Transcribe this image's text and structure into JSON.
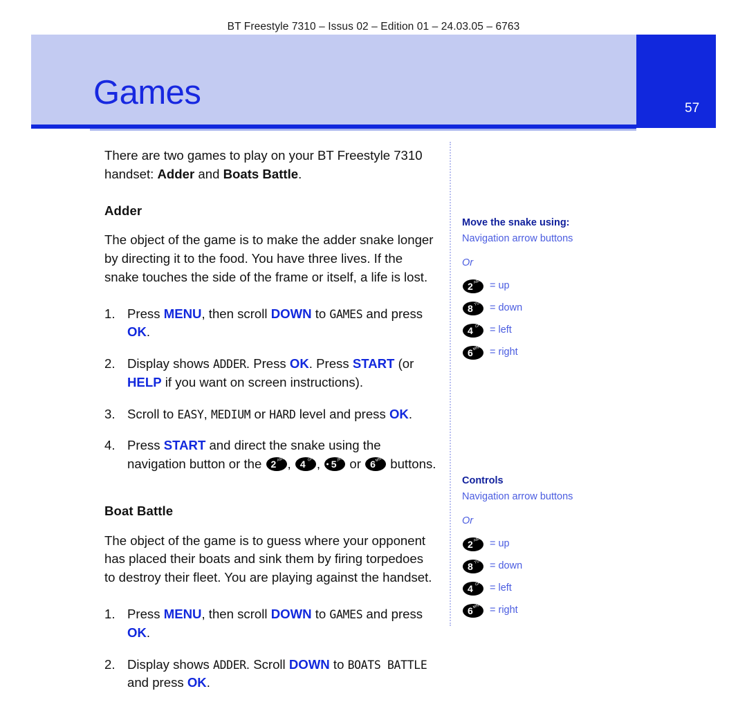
{
  "header": {
    "running_head": "BT Freestyle 7310 – Issus 02 – Edition 01 – 24.03.05 – 6763"
  },
  "banner": {
    "title": "Games",
    "page_number": "57",
    "bg_color": "#c3cbf2",
    "title_color": "#1728e0",
    "page_block_color": "#1128dd"
  },
  "main": {
    "intro": {
      "t1": "There are two games to play on your BT Freestyle 7310 handset: ",
      "b1": "Adder",
      "t2": " and ",
      "b2": "Boats Battle",
      "t3": "."
    },
    "adder": {
      "heading": "Adder",
      "description": "The object of the game is to make the adder snake longer by directing it to the food. You have three lives. If the snake touches the side of the frame or itself, a life is lost.",
      "steps": [
        {
          "num": "1.",
          "p1": "Press ",
          "k1": "MENU",
          "p2": ", then scroll ",
          "k2": "DOWN",
          "p3": " to ",
          "lcd1": "GAMES",
          "p4": " and press ",
          "k3": "OK",
          "p5": "."
        },
        {
          "num": "2.",
          "p1": "Display shows ",
          "lcd1": "ADDER",
          "p2": ". Press ",
          "k1": "OK",
          "p3": ". Press ",
          "k2": "START",
          "p4": " (or ",
          "k3": "HELP",
          "p5": " if you want on screen instructions)."
        },
        {
          "num": "3.",
          "p1": "Scroll to ",
          "lcd1": "EASY",
          "p2": ", ",
          "lcd2": "MEDIUM",
          "p3": " or ",
          "lcd3": "HARD",
          "p4": " level and press ",
          "k1": "OK",
          "p5": "."
        },
        {
          "num": "4.",
          "p1": "Press ",
          "k1": "START",
          "p2": " and direct the snake using the navigation button or the ",
          "p3": ", ",
          "p4": ", ",
          "p5": " or ",
          "p6": " buttons."
        }
      ],
      "step4_keys": [
        {
          "digit": "2",
          "letters": "ABC",
          "dot": false
        },
        {
          "digit": "4",
          "letters": "GHI",
          "dot": false
        },
        {
          "digit": "5",
          "letters": "JKL",
          "dot": true
        },
        {
          "digit": "6",
          "letters": "MNO",
          "dot": false
        }
      ]
    },
    "boat": {
      "heading": "Boat Battle",
      "description": "The object of the game is to guess where your opponent has placed their boats and sink them by firing torpedoes to destroy their fleet. You are playing against the handset.",
      "steps": [
        {
          "num": "1.",
          "p1": "Press ",
          "k1": "MENU",
          "p2": ", then scroll ",
          "k2": "DOWN",
          "p3": " to ",
          "lcd1": "GAMES",
          "p4": " and press ",
          "k3": "OK",
          "p5": "."
        },
        {
          "num": "2.",
          "p1": "Display shows ",
          "lcd1": "ADDER",
          "p2": ". Scroll ",
          "k1": "DOWN",
          "p3": " to ",
          "lcd2": "BOATS BATTLE",
          "p4": " and press ",
          "k2": "OK",
          "p5": "."
        }
      ]
    }
  },
  "sidebar": {
    "accent_heading_color": "#10209c",
    "accent_body_color": "#4a5ce0",
    "blocks": [
      {
        "heading": "Move the snake using:",
        "subtitle": "Navigation arrow buttons",
        "or_label": "Or",
        "rows": [
          {
            "digit": "2",
            "letters": "ABC",
            "label": "= up"
          },
          {
            "digit": "8",
            "letters": "TUV",
            "label": "= down"
          },
          {
            "digit": "4",
            "letters": "GHI",
            "label": "= left"
          },
          {
            "digit": "6",
            "letters": "MNO",
            "label": "= right"
          }
        ]
      },
      {
        "heading": "Controls",
        "subtitle": "Navigation arrow buttons",
        "or_label": "Or",
        "rows": [
          {
            "digit": "2",
            "letters": "ABC",
            "label": "= up"
          },
          {
            "digit": "8",
            "letters": "TUV",
            "label": "= down"
          },
          {
            "digit": "4",
            "letters": "GHI",
            "label": "= left"
          },
          {
            "digit": "6",
            "letters": "MNO",
            "label": "= right"
          }
        ]
      }
    ]
  }
}
